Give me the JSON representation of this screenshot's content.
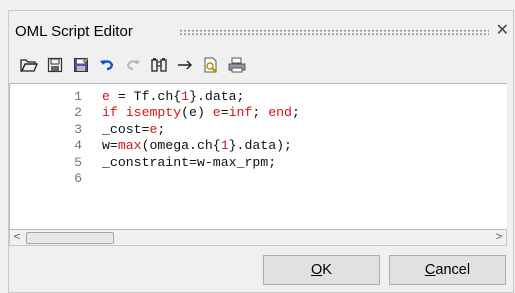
{
  "window": {
    "title": "OML Script Editor",
    "close_glyph": "✕"
  },
  "toolbar": {
    "buttons": [
      {
        "name": "open-folder-icon"
      },
      {
        "name": "save-icon"
      },
      {
        "name": "save-as-icon"
      },
      {
        "name": "undo-icon"
      },
      {
        "name": "redo-icon"
      },
      {
        "name": "find-icon"
      },
      {
        "name": "goto-arrow-icon"
      },
      {
        "name": "print-preview-icon"
      },
      {
        "name": "print-icon"
      }
    ]
  },
  "editor": {
    "lines": [
      {
        "number": "1",
        "parts": [
          {
            "text": "e",
            "style": "kw"
          },
          {
            "text": " = Tf.ch{",
            "style": ""
          },
          {
            "text": "1",
            "style": "num"
          },
          {
            "text": "}.data;",
            "style": ""
          }
        ]
      },
      {
        "number": "2",
        "parts": [
          {
            "text": "if isempty",
            "style": "kw"
          },
          {
            "text": "(e) ",
            "style": ""
          },
          {
            "text": "e",
            "style": "kw"
          },
          {
            "text": "=",
            "style": ""
          },
          {
            "text": "inf",
            "style": "kw"
          },
          {
            "text": "; ",
            "style": ""
          },
          {
            "text": "end",
            "style": "kw"
          },
          {
            "text": ";",
            "style": ""
          }
        ]
      },
      {
        "number": "3",
        "parts": [
          {
            "text": "_cost=",
            "style": ""
          },
          {
            "text": "e",
            "style": "kw"
          },
          {
            "text": ";",
            "style": ""
          }
        ]
      },
      {
        "number": "4",
        "parts": [
          {
            "text": "w=",
            "style": ""
          },
          {
            "text": "max",
            "style": "kw"
          },
          {
            "text": "(omega.ch{",
            "style": ""
          },
          {
            "text": "1",
            "style": "num"
          },
          {
            "text": "}.data);",
            "style": ""
          }
        ]
      },
      {
        "number": "5",
        "parts": [
          {
            "text": "_constraint=w-max_rpm;",
            "style": ""
          }
        ]
      },
      {
        "number": "6",
        "parts": []
      }
    ]
  },
  "scrollbar": {
    "left_arrow": "<",
    "right_arrow": ">"
  },
  "buttons": {
    "ok_mnemonic": "O",
    "ok_rest": "K",
    "cancel_mnemonic": "C",
    "cancel_rest": "ancel"
  },
  "colors": {
    "keyword": "#d31414",
    "text": "#111111",
    "line_number": "#777777"
  }
}
